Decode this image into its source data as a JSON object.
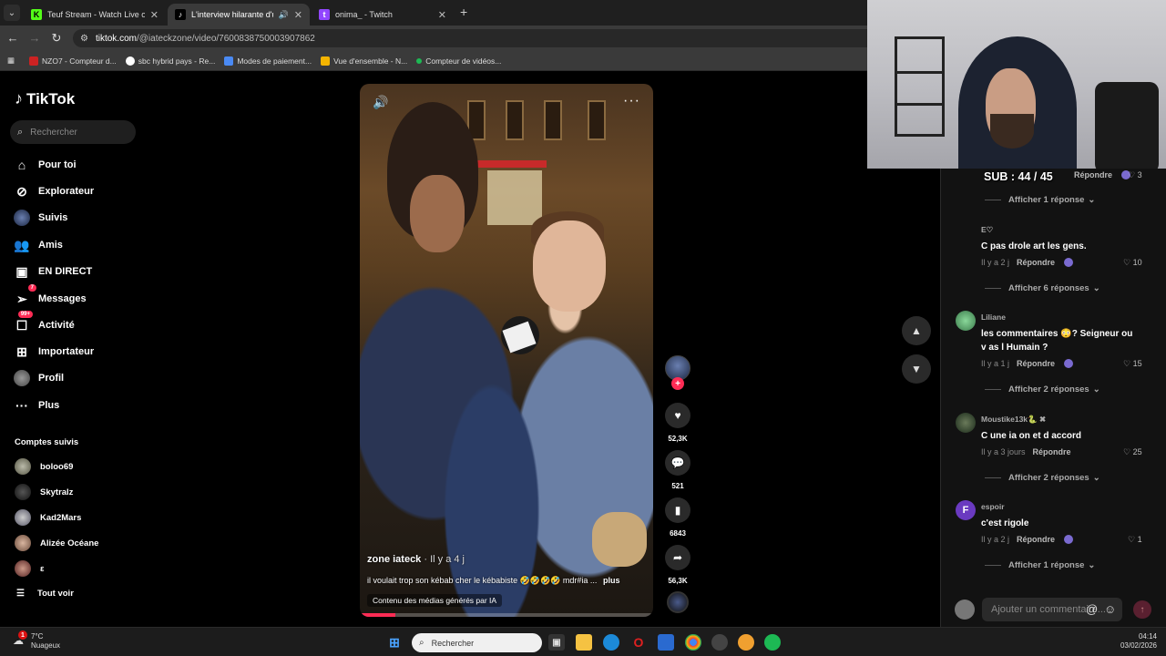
{
  "browser": {
    "tabs": [
      {
        "title": "Teuf Stream - Watch Live on Kick",
        "active": false
      },
      {
        "title": "L'interview hilarante d'un kébab",
        "active": true
      },
      {
        "title": "onima_ - Twitch",
        "active": false
      }
    ],
    "url_domain": "tiktok.com",
    "url_path": "/@iateckzone/video/7600838750003907862",
    "bookmarks": [
      "NZO7 - Compteur d...",
      "sbc hybrid pays - Re...",
      "Modes de paiement...",
      "Vue d'ensemble - N...",
      "Compteur de vidéos..."
    ]
  },
  "sidebar": {
    "logo": "TikTok",
    "search_placeholder": "Rechercher",
    "nav": [
      {
        "label": "Pour toi",
        "icon": "home-icon",
        "badge": ""
      },
      {
        "label": "Explorateur",
        "icon": "compass-icon",
        "badge": ""
      },
      {
        "label": "Suivis",
        "icon": "avatar-icon",
        "badge": ""
      },
      {
        "label": "Amis",
        "icon": "friends-icon",
        "badge": ""
      },
      {
        "label": "EN DIRECT",
        "icon": "live-icon",
        "badge": ""
      },
      {
        "label": "Messages",
        "icon": "messages-icon",
        "badge": "7"
      },
      {
        "label": "Activité",
        "icon": "activity-icon",
        "badge": "99+"
      },
      {
        "label": "Importateur",
        "icon": "upload-icon",
        "badge": ""
      },
      {
        "label": "Profil",
        "icon": "profile-icon",
        "badge": ""
      },
      {
        "label": "Plus",
        "icon": "more-icon",
        "badge": ""
      }
    ],
    "following_title": "Comptes suivis",
    "following": [
      "boloo69",
      "Skytralz",
      "Kad2Mars",
      "Alizée Océane",
      "ε"
    ],
    "see_all": "Tout voir"
  },
  "video": {
    "author": "zone iateck",
    "time": "· Il y a 4 j",
    "description": "il voulait trop son kébab cher le kébabiste 🤣🤣🤣🤣 mdr#ia ...",
    "more": "plus",
    "ai_label": "Contenu des médias générés par IA",
    "progress": 0.12,
    "likes": "52,3K",
    "comments": "521",
    "saves": "6843",
    "shares": "56,3K"
  },
  "comments": {
    "top_partial": {
      "reply": "Répondre",
      "likes": "3",
      "view": "Afficher 1 réponse"
    },
    "items": [
      {
        "name": "E♡",
        "text": "C pas drole art les gens.",
        "time": "Il y a 2 j",
        "reply": "Répondre",
        "likes": "10",
        "view": "Afficher 6 réponses",
        "avatar": "",
        "color": ""
      },
      {
        "name": "Liliane",
        "text": "les commentaires 😳? Seigneur ou v as l Humain ?",
        "time": "Il y a 1 j",
        "reply": "Répondre",
        "likes": "15",
        "view": "Afficher 2 réponses",
        "avatar": "",
        "color": "#6ac07a"
      },
      {
        "name": "Moustike13k🐍 ✖",
        "text": "C une ia on et d accord",
        "time": "Il y a 3 jours",
        "reply": "Répondre",
        "likes": "25",
        "view": "Afficher 2 réponses",
        "avatar": "",
        "color": "#3a4a3a"
      },
      {
        "name": "espoir",
        "text": "c'est rigole",
        "time": "Il y a 2 j",
        "reply": "Répondre",
        "likes": "1",
        "view": "Afficher 1 réponse",
        "avatar": "F",
        "color": "#6a3ac0"
      }
    ],
    "input_placeholder": "Ajouter un commentaire..."
  },
  "overlay": {
    "sub_count": "SUB : 44 / 45"
  },
  "taskbar": {
    "temperature": "7°C",
    "weather": "Nuageux",
    "weather_badge": "1",
    "search_placeholder": "Rechercher",
    "time": "04:14",
    "date": "03/02/2026"
  }
}
